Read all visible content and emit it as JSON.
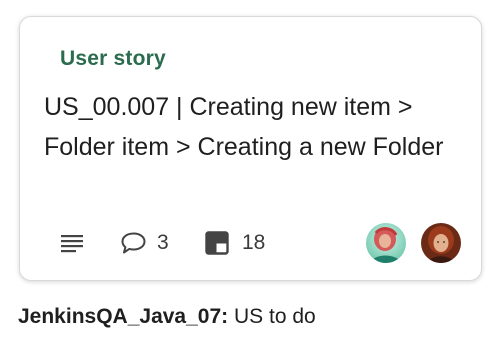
{
  "card": {
    "type_label": "User story",
    "title": "US_00.007 | Creating new item > Folder item > Creating a new Folder",
    "comment_count": "3",
    "task_count": "18",
    "icons": {
      "description": "description-lines-icon",
      "comments": "comment-bubble-icon",
      "tasks": "board-icon"
    },
    "assignees": [
      "avatar",
      "avatar"
    ],
    "colors": {
      "type_label": "#2b6b4e",
      "border": "#d9d9d9"
    }
  },
  "board": {
    "owner": "JenkinsQA_Java_07:",
    "status": "US to do"
  }
}
